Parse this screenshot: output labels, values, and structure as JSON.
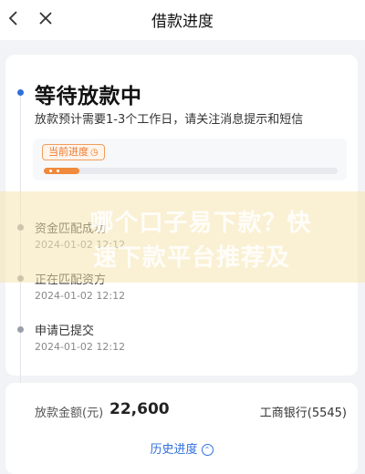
{
  "nav": {
    "title": "借款进度",
    "back_icon": "chevron-left-icon",
    "close_icon": "close-icon"
  },
  "status": {
    "title": "等待放款中",
    "description": "放款预计需要1-3个工作日，请关注消息提示和短信"
  },
  "progress": {
    "tag_label": "当前进度",
    "tag_icon": "clock-icon",
    "fill_fraction": 0.12,
    "accent": "#f08a3c"
  },
  "steps": [
    {
      "name": "资金匹配成功",
      "time": "2024-01-02 12:12"
    },
    {
      "name": "正在匹配资方",
      "time": "2024-01-02 12:12"
    },
    {
      "name": "申请已提交",
      "time": "2024-01-02 12:12"
    }
  ],
  "summary": {
    "amount_label": "放款金额(元)",
    "amount_value": "22,600",
    "bank": "工商银行(5545)",
    "history_label": "历史进度",
    "history_icon": "chevron-up-circle-icon"
  },
  "watermark": {
    "line1": "哪个口子易下款？快",
    "line2": "速下款平台推荐及"
  },
  "colors": {
    "primary": "#2f6fde",
    "orange": "#f08a3c"
  }
}
